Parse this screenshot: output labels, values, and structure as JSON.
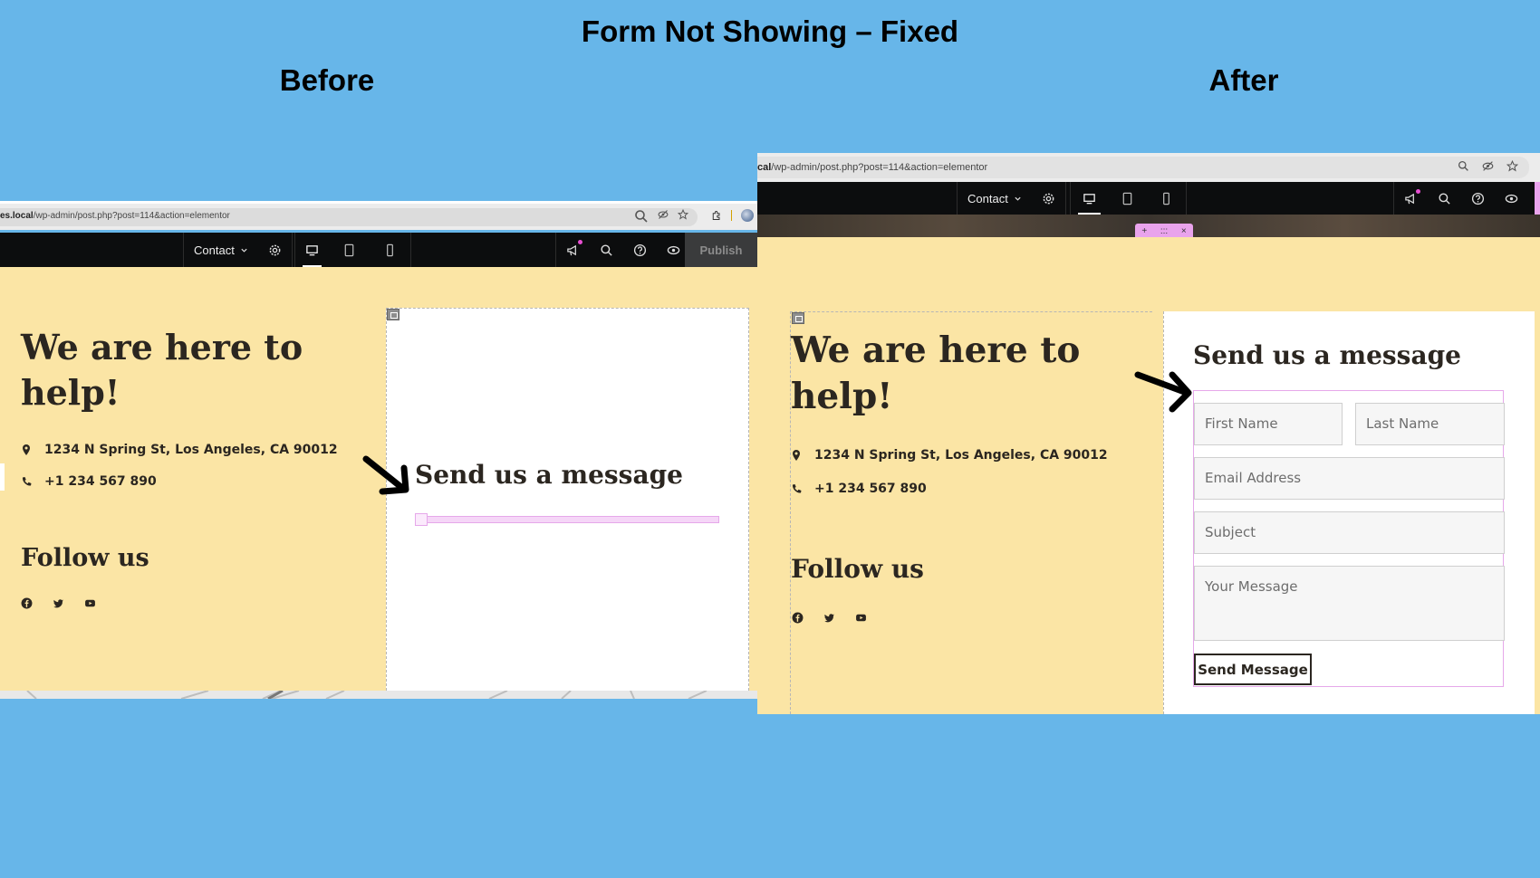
{
  "title": "Form Not Showing – Fixed",
  "before_label": "Before",
  "after_label": "After",
  "colors": {
    "background": "#67b6e9",
    "canvas": "#fbe5a5",
    "toolbar": "#0c0d0e",
    "accent_pink": "#e9a3ec",
    "text": "#2b2620"
  },
  "before": {
    "url_host": "es.local",
    "url_path": "/wp-admin/post.php?post=114&action=elementor",
    "toolbar": {
      "page_name": "Contact",
      "publish_label": "Publish"
    },
    "heading_line1": "We are here to",
    "heading_line2": "help!",
    "address": "1234 N Spring St, Los Angeles, CA 90012",
    "phone": "+1 234 567 890",
    "follow_label": "Follow us",
    "form_title": "Send us a message"
  },
  "after": {
    "url_host": "cal",
    "url_path": "/wp-admin/post.php?post=114&action=elementor",
    "toolbar": {
      "page_name": "Contact"
    },
    "handle_add": "+",
    "handle_move": ":::",
    "handle_close": "×",
    "heading_line1": "We are here to",
    "heading_line2": "help!",
    "address": "1234 N Spring St, Los Angeles, CA 90012",
    "phone": "+1 234 567 890",
    "follow_label": "Follow us",
    "form_title": "Send us a message",
    "form": {
      "first_name": "First Name",
      "last_name": "Last Name",
      "email": "Email Address",
      "subject": "Subject",
      "message": "Your Message",
      "submit": "Send Message"
    }
  },
  "icons": {
    "toolbar": [
      "chevron-down-icon",
      "gear-icon",
      "desktop-icon",
      "tablet-icon",
      "mobile-icon",
      "megaphone-icon",
      "search-icon",
      "help-icon",
      "eye-icon"
    ],
    "info": [
      "map-pin-icon",
      "phone-icon"
    ],
    "social": [
      "facebook-icon",
      "twitter-icon",
      "youtube-icon"
    ]
  }
}
